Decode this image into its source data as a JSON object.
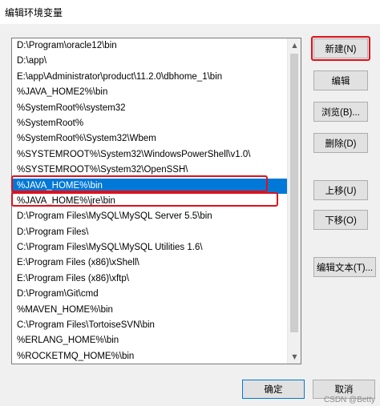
{
  "window": {
    "title": "编辑环境变量"
  },
  "paths": [
    "D:\\Program\\oracle12\\bin",
    "D:\\app\\",
    "E:\\app\\Administrator\\product\\11.2.0\\dbhome_1\\bin",
    "%JAVA_HOME2%\\bin",
    "%SystemRoot%\\system32",
    "%SystemRoot%",
    "%SystemRoot%\\System32\\Wbem",
    "%SYSTEMROOT%\\System32\\WindowsPowerShell\\v1.0\\",
    "%SYSTEMROOT%\\System32\\OpenSSH\\",
    "%JAVA_HOME%\\bin",
    "%JAVA_HOME%\\jre\\bin",
    "D:\\Program Files\\MySQL\\MySQL Server 5.5\\bin",
    "D:\\Program Files\\",
    "C:\\Program Files\\MySQL\\MySQL Utilities 1.6\\",
    "E:\\Program Files (x86)\\xShell\\",
    "E:\\Program Files (x86)\\xftp\\",
    "D:\\Program\\Git\\cmd",
    "%MAVEN_HOME%\\bin",
    "C:\\Program Files\\TortoiseSVN\\bin",
    "%ERLANG_HOME%\\bin",
    "%ROCKETMQ_HOME%\\bin"
  ],
  "selected_index": 9,
  "buttons": {
    "new": "新建(N)",
    "edit": "编辑",
    "browse": "浏览(B)...",
    "delete": "删除(D)",
    "move_up": "上移(U)",
    "move_down": "下移(O)",
    "edit_text": "编辑文本(T)...",
    "ok": "确定",
    "cancel": "取消"
  },
  "watermark": "CSDN @Betty",
  "colors": {
    "selection": "#0078d7",
    "annotation": "#e0101a"
  }
}
